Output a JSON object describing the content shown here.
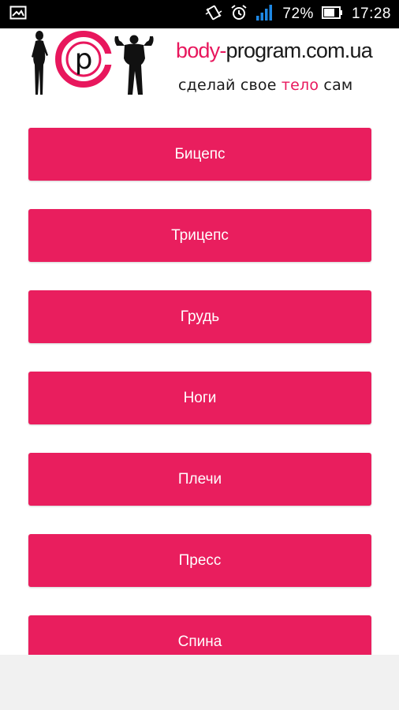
{
  "status_bar": {
    "left_icons": [
      "image-icon"
    ],
    "right_icons": [
      "vibrate-icon",
      "alarm-icon",
      "signal-icon",
      "battery-icon"
    ],
    "battery_text": "72%",
    "time": "17:28",
    "signal_color": "#1e88e5"
  },
  "header": {
    "logo_letter": "p",
    "site_name_part1": "body-",
    "site_name_part2": "program.com.ua",
    "tagline_part1": "сделай свое ",
    "tagline_part2": "тело",
    "tagline_part3": " сам",
    "brand_color": "#e8175d"
  },
  "menu": {
    "items": [
      {
        "label": "Бицепс"
      },
      {
        "label": "Трицепс"
      },
      {
        "label": "Грудь"
      },
      {
        "label": "Ноги"
      },
      {
        "label": "Плечи"
      },
      {
        "label": "Пресс"
      },
      {
        "label": "Спина"
      }
    ],
    "button_color": "#e91e5e"
  }
}
